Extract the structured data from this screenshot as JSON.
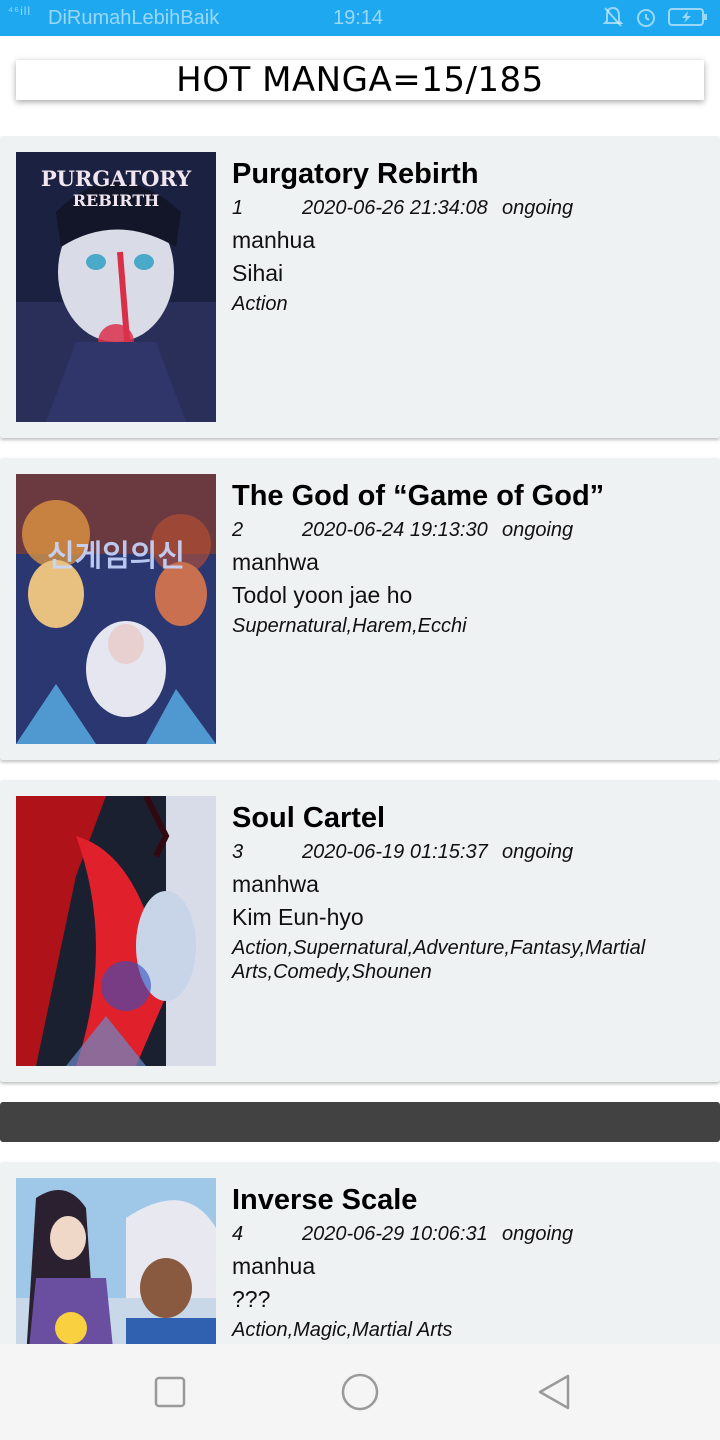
{
  "status_bar": {
    "signal": "⁴⁶ill",
    "carrier": "DiRumahLebihBaik",
    "time": "19:14",
    "icons": [
      "bell-off-icon",
      "alarm-icon",
      "battery-charging-icon"
    ]
  },
  "header": {
    "title": "HOT MANGA=15/185"
  },
  "manga": [
    {
      "title": "Purgatory Rebirth",
      "rank": "1",
      "date": "2020-06-26 21:34:08",
      "status": "ongoing",
      "type": "manhua",
      "author": "Sihai",
      "genres": "Action",
      "cover_text": [
        "PURGATORY",
        "REBIRTH"
      ],
      "colors": {
        "bg": "#1b2140",
        "accent": "#d9304a",
        "skin": "#d9dbe6"
      }
    },
    {
      "title": "The God of “Game of God”",
      "rank": "2",
      "date": "2020-06-24 19:13:30",
      "status": "ongoing",
      "type": "manhwa",
      "author": "Todol yoon jae ho",
      "genres": "Supernatural,Harem,Ecchi",
      "cover_text": [
        "신게임의신"
      ],
      "colors": {
        "bg": "#2a3770",
        "accent": "#f0a040",
        "skin": "#e8d0d0"
      }
    },
    {
      "title": "Soul Cartel",
      "rank": "3",
      "date": "2020-06-19 01:15:37",
      "status": "ongoing",
      "type": "manhwa",
      "author": "Kim Eun-hyo",
      "genres": "Action,Supernatural,Adventure,Fantasy,Martial Arts,Comedy,Shounen",
      "cover_text": [],
      "colors": {
        "bg": "#1a2030",
        "accent": "#e0202a",
        "skin": "#c8d4e8"
      }
    },
    {
      "title": "Inverse Scale",
      "rank": "4",
      "date": "2020-06-29 10:06:31",
      "status": "ongoing",
      "type": "manhua",
      "author": "???",
      "genres": "Action,Magic,Martial Arts",
      "cover_text": [],
      "colors": {
        "bg": "#9fc8e8",
        "accent": "#6a4fa0",
        "skin": "#f0d8c8"
      }
    }
  ],
  "nav_bar": {
    "buttons": [
      "recents-icon",
      "home-icon",
      "back-icon"
    ]
  }
}
